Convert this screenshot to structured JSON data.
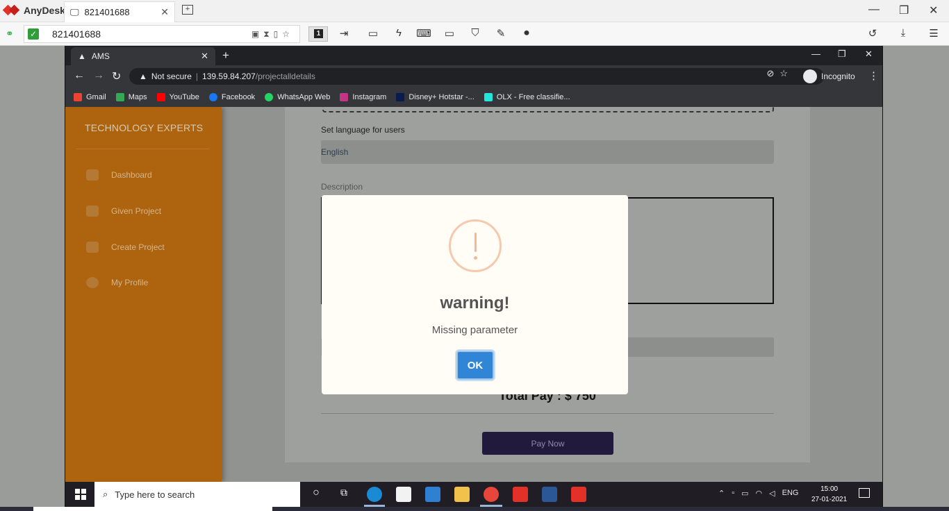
{
  "anydesk": {
    "app_name": "AnyDesk",
    "tab_label": "821401688",
    "address_value": "821401688",
    "monitor_number": "1"
  },
  "chrome": {
    "tab_title": "AMS",
    "url_warning": "Not secure",
    "url_host": "139.59.84.207",
    "url_path": "/projectalldetails",
    "incognito_label": "Incognito",
    "bookmarks": [
      {
        "label": "Gmail",
        "color": "#ea4335"
      },
      {
        "label": "Maps",
        "color": "#34a853"
      },
      {
        "label": "YouTube",
        "color": "#ff0000"
      },
      {
        "label": "Facebook",
        "color": "#1877f2"
      },
      {
        "label": "WhatsApp Web",
        "color": "#25d366"
      },
      {
        "label": "Instagram",
        "color": "#c13584"
      },
      {
        "label": "Disney+ Hotstar -...",
        "color": "#0c1b4d"
      },
      {
        "label": "OLX - Free classifie...",
        "color": "#23e5db"
      }
    ]
  },
  "sidebar": {
    "brand": "TECHNOLOGY EXPERTS",
    "items": [
      {
        "label": "Dashboard",
        "icon": "chart-icon"
      },
      {
        "label": "Given Project",
        "icon": "user-icon"
      },
      {
        "label": "Create Project",
        "icon": "chat-icon"
      },
      {
        "label": "My Profile",
        "icon": "gear-icon"
      }
    ]
  },
  "form": {
    "language_label": "Set language for users",
    "language_value": "English",
    "description_label": "Description",
    "total_pay": "Total Pay : $ 750",
    "pay_button": "Pay Now"
  },
  "modal": {
    "title": "warning!",
    "message": "Missing parameter",
    "ok_label": "OK"
  },
  "taskbar": {
    "search_placeholder": "Type here to search",
    "language": "ENG",
    "time": "15:00",
    "date": "27-01-2021"
  }
}
